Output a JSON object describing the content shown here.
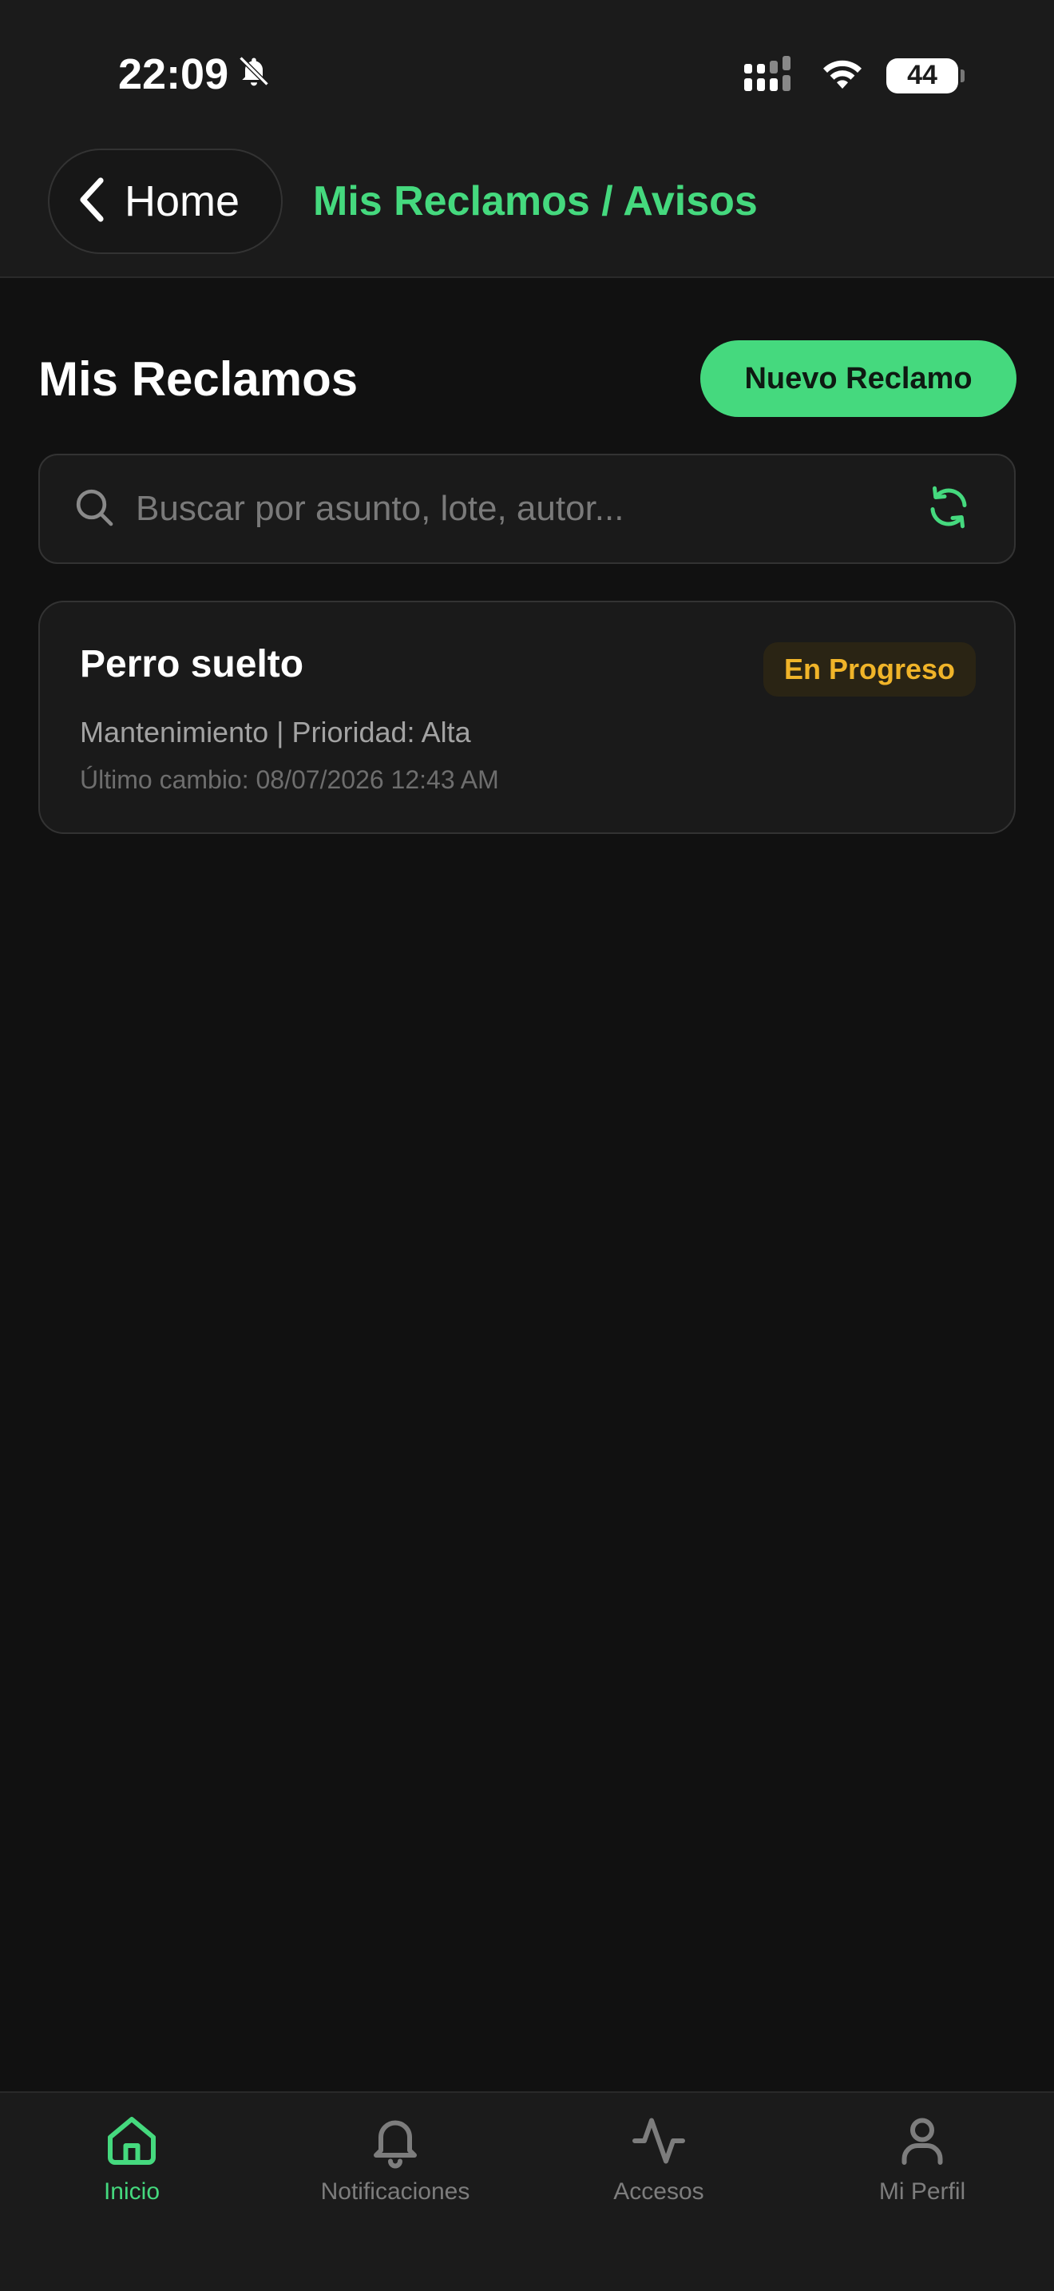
{
  "status_bar": {
    "time": "22:09",
    "battery": "44"
  },
  "header": {
    "back_label": "Home",
    "title": "Mis Reclamos / Avisos"
  },
  "main": {
    "heading": "Mis Reclamos",
    "new_button_label": "Nuevo Reclamo",
    "search": {
      "placeholder": "Buscar por asunto, lote, autor...",
      "value": ""
    },
    "claims": [
      {
        "title": "Perro suelto",
        "status": "En Progreso",
        "meta": "Mantenimiento | Prioridad: Alta",
        "updated": "Último cambio: 08/07/2026 12:43 AM"
      }
    ]
  },
  "tabbar": {
    "items": [
      {
        "label": "Inicio",
        "icon": "home-icon",
        "active": true
      },
      {
        "label": "Notificaciones",
        "icon": "bell-icon",
        "active": false
      },
      {
        "label": "Accesos",
        "icon": "activity-icon",
        "active": false
      },
      {
        "label": "Mi Perfil",
        "icon": "user-icon",
        "active": false
      }
    ]
  },
  "colors": {
    "accent": "#45d97e",
    "status_in_progress": "#f0b429",
    "background": "#111111",
    "surface": "#1a1a1a"
  }
}
